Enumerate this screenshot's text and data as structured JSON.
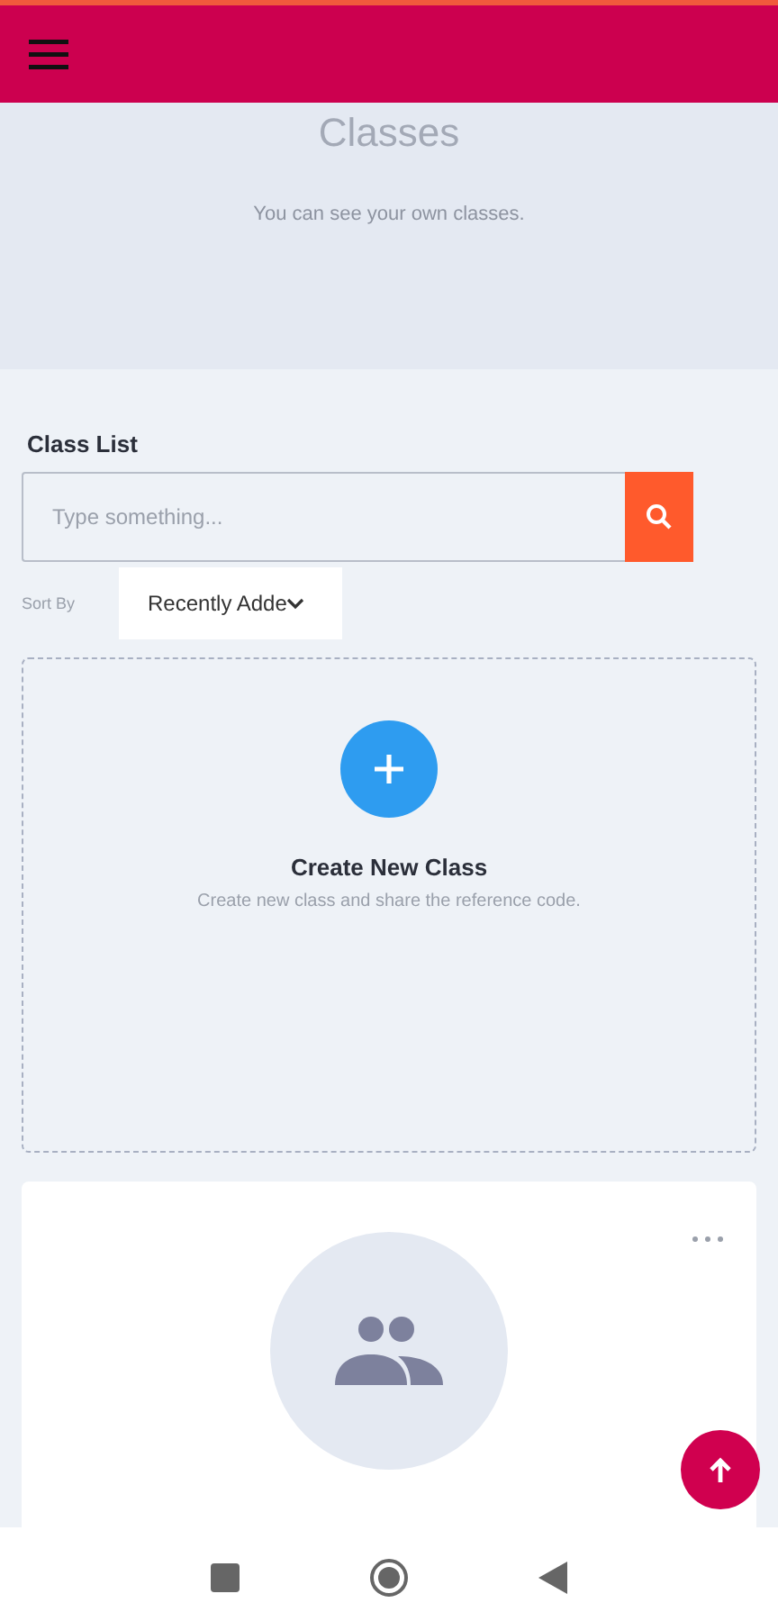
{
  "header": {
    "title": "Classes",
    "subtitle": "You can see your own classes."
  },
  "class_list": {
    "heading": "Class List",
    "search": {
      "placeholder": "Type something..."
    },
    "sort": {
      "label": "Sort By",
      "value": "Recently Adde"
    }
  },
  "create_card": {
    "title": "Create New Class",
    "description": "Create new class and share the reference code."
  },
  "classes": [
    {
      "kind": "group"
    }
  ]
}
